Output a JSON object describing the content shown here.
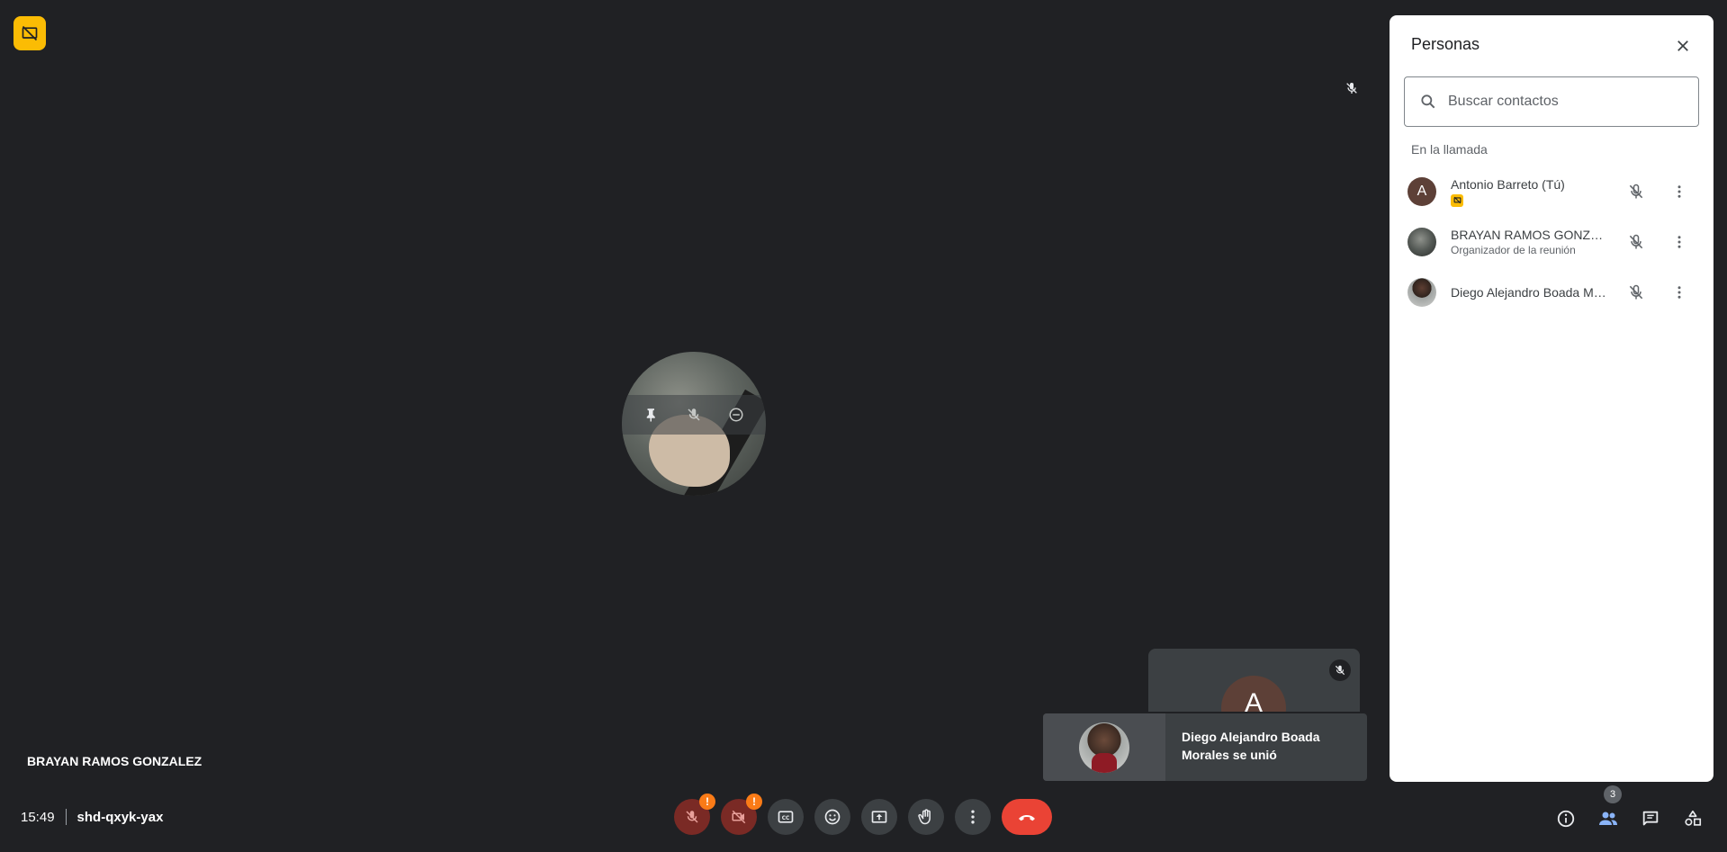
{
  "stage": {
    "speaker_name": "BRAYAN RAMOS GONZALEZ",
    "icons": [
      "no-present-icon",
      "mic-off-icon",
      "pin-icon",
      "remove-icon"
    ]
  },
  "self_tile": {
    "initial": "A"
  },
  "toast": {
    "message": "Diego Alejandro Boada Morales se unió"
  },
  "meeting": {
    "time": "15:49",
    "code": "shd-qxyk-yax"
  },
  "controls": {
    "mic_warning": "!",
    "camera_warning": "!"
  },
  "right_controls": {
    "people_count": "3"
  },
  "panel": {
    "title": "Personas",
    "search_placeholder": "Buscar contactos",
    "section_title": "En la llamada",
    "participants": [
      {
        "initial": "A",
        "name": "Antonio Barreto (Tú)",
        "sub": ""
      },
      {
        "initial": "",
        "name": "BRAYAN RAMOS GONZALEZ",
        "sub": "Organizador de la reunión"
      },
      {
        "initial": "",
        "name": "Diego Alejandro Boada Mo...",
        "sub": ""
      }
    ]
  },
  "colors": {
    "background": "#202124",
    "accent_yellow": "#fbbc04",
    "hangup_red": "#ea4335",
    "warning_orange": "#fa7b17",
    "avatar_brown": "#5d4037"
  }
}
